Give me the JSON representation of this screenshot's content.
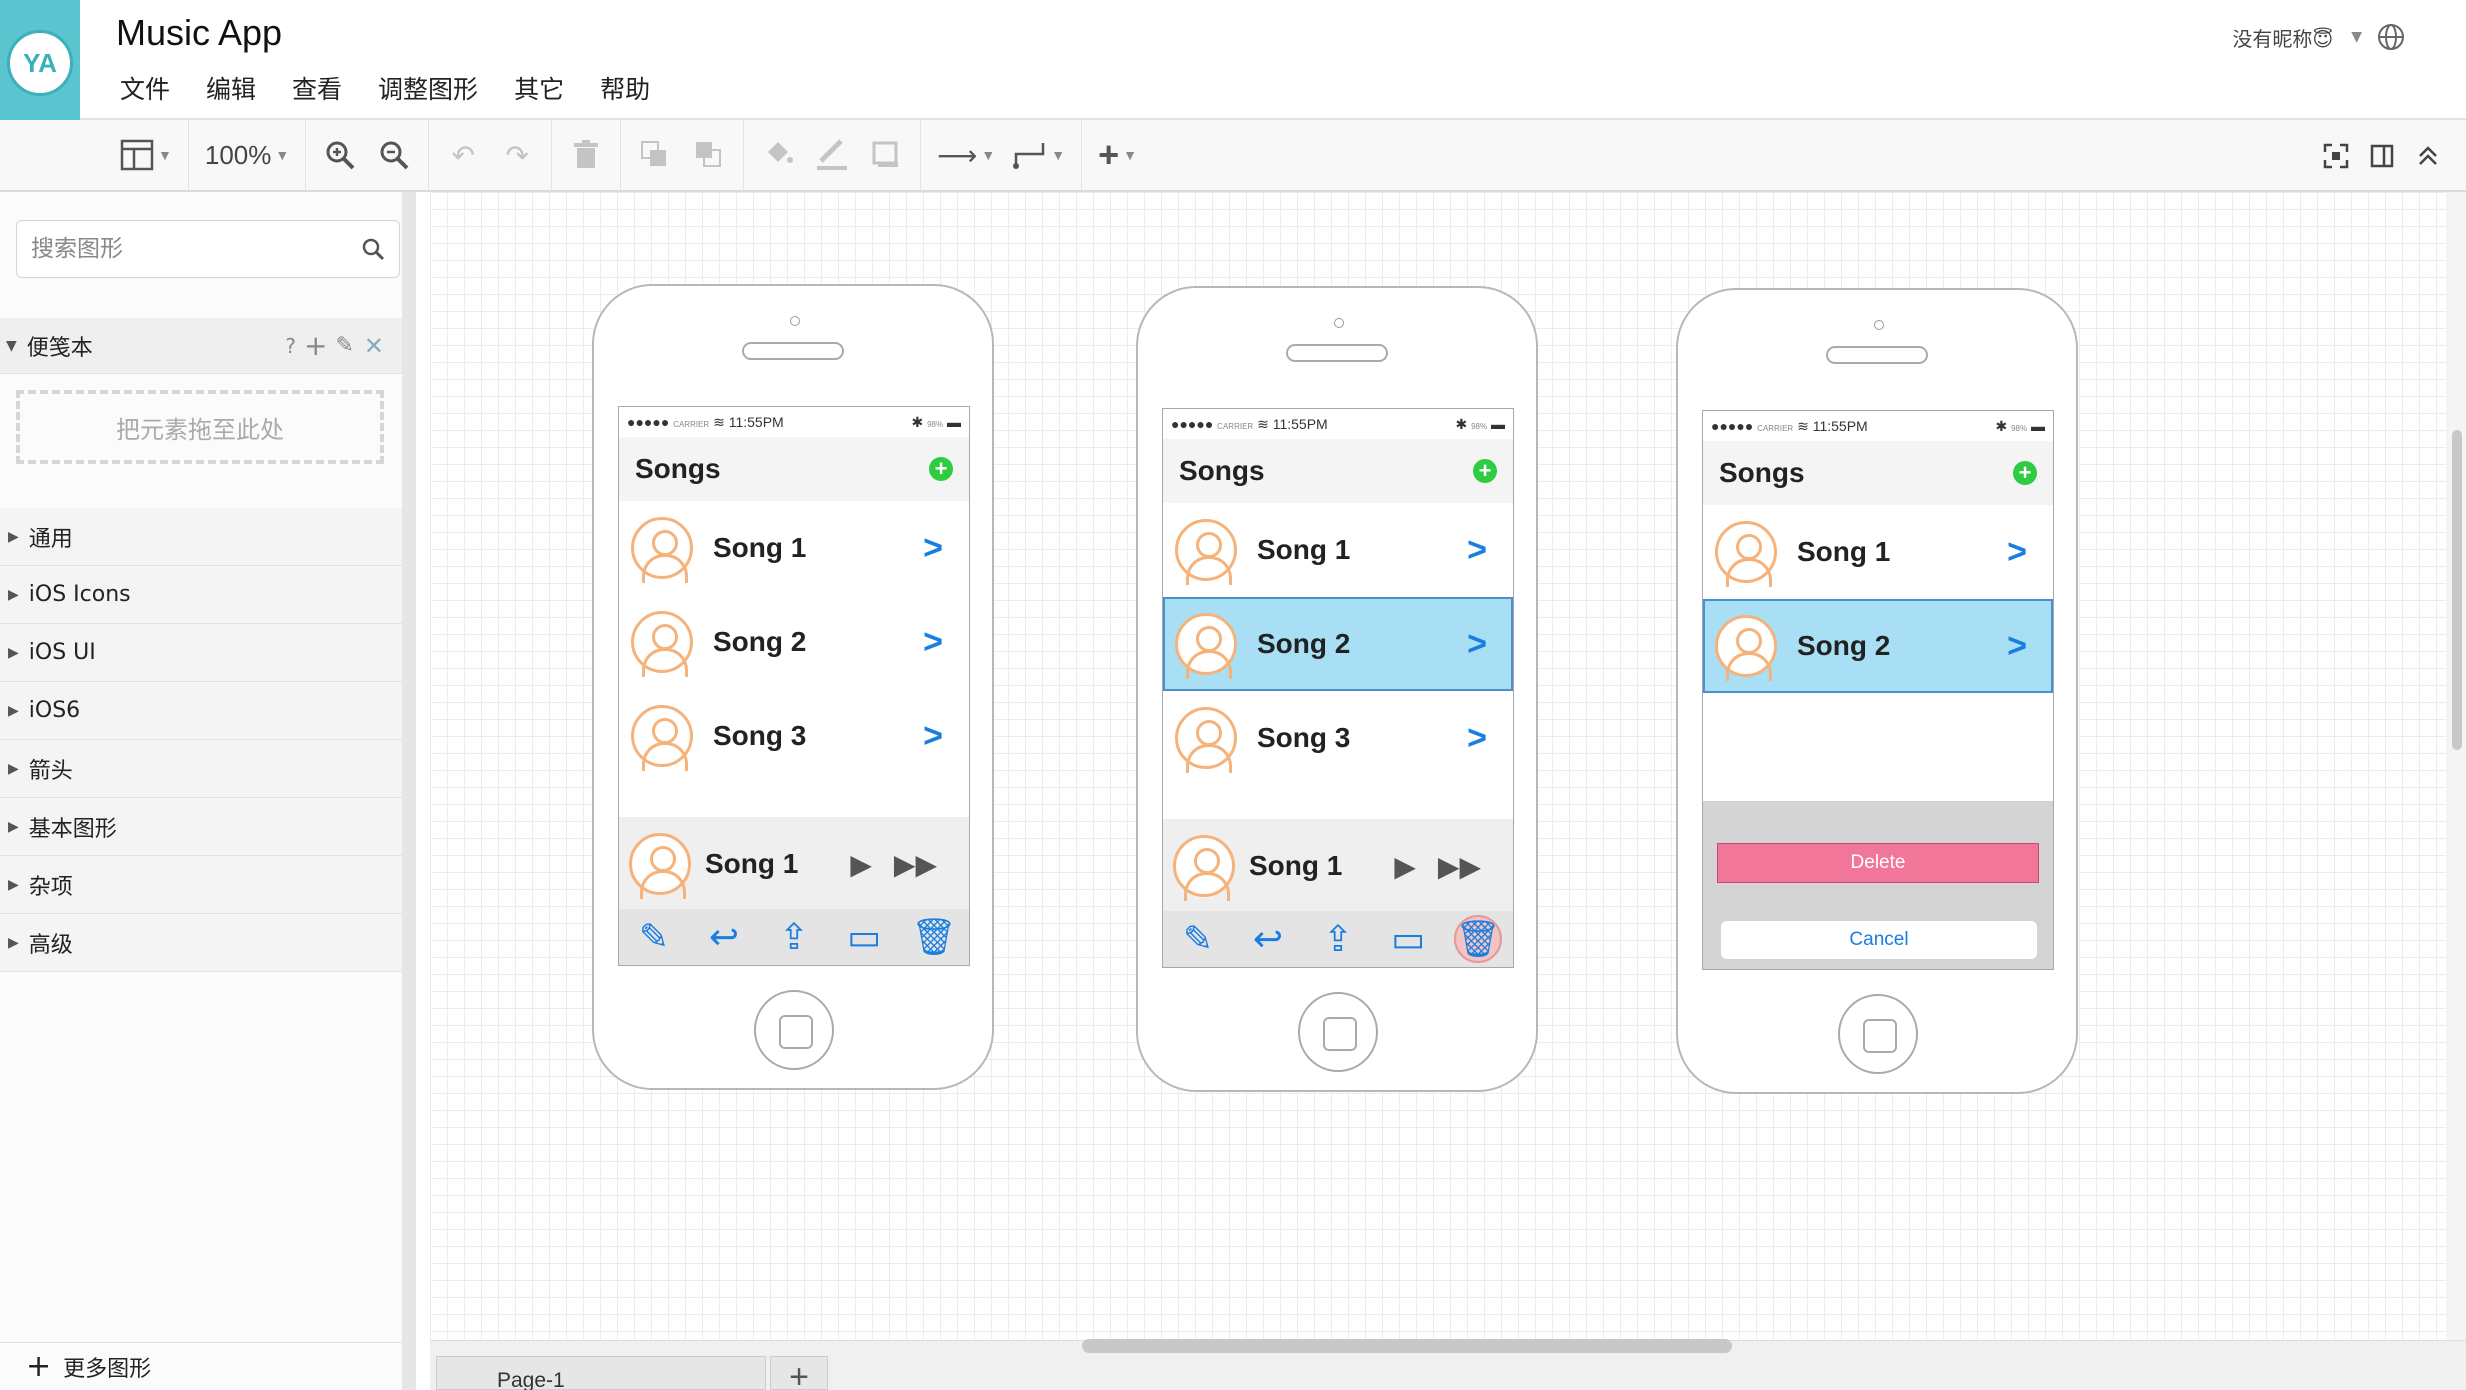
{
  "app": {
    "logo": "YA",
    "title": "Music App"
  },
  "menu": [
    "文件",
    "编辑",
    "查看",
    "调整图形",
    "其它",
    "帮助"
  ],
  "user": {
    "name": "没有昵称😇"
  },
  "toolbar": {
    "zoom": "100%"
  },
  "sidebar": {
    "search_placeholder": "搜索图形",
    "scratchpad": {
      "title": "便笺本",
      "help": "?",
      "drop_hint": "把元素拖至此处"
    },
    "categories": [
      "通用",
      "iOS Icons",
      "iOS UI",
      "iOS6",
      "箭头",
      "基本图形",
      "杂项",
      "高级"
    ],
    "more": "更多图形"
  },
  "pages": {
    "tab": "Page-1"
  },
  "phones": [
    {
      "status": {
        "carrier": "CARRIER",
        "time": "11:55PM",
        "battery": "98%"
      },
      "nav_title": "Songs",
      "songs": [
        "Song 1",
        "Song 2",
        "Song 3"
      ],
      "player": {
        "song": "Song 1"
      }
    },
    {
      "status": {
        "carrier": "CARRIER",
        "time": "11:55PM",
        "battery": "98%"
      },
      "nav_title": "Songs",
      "songs": [
        "Song 1",
        "Song 2",
        "Song 3"
      ],
      "selected": "Song 2",
      "player": {
        "song": "Song 1"
      }
    },
    {
      "status": {
        "carrier": "CARRIER",
        "time": "11:55PM",
        "battery": "98%"
      },
      "nav_title": "Songs",
      "songs": [
        "Song 1",
        "Song 2"
      ],
      "selected": "Song 2",
      "action_sheet": {
        "delete": "Delete",
        "cancel": "Cancel"
      }
    }
  ],
  "colors": {
    "logo_bg": "#5bc5cf",
    "accent": "#1a7ee0",
    "selection": "#a8dff5",
    "delete": "#f2769a",
    "add": "#2ecc40"
  }
}
